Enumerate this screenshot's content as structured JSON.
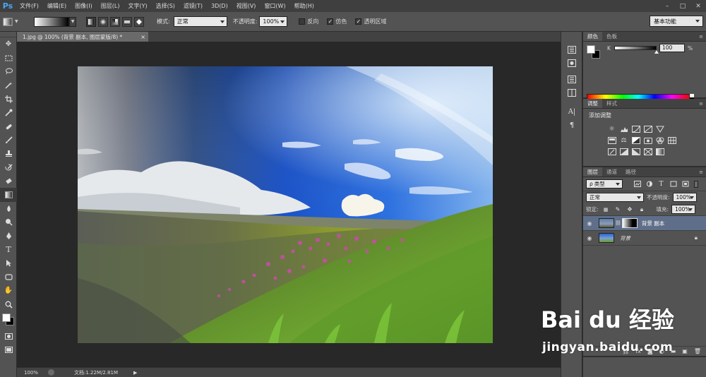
{
  "app": {
    "logo": "Ps"
  },
  "menu": [
    "文件(F)",
    "编辑(E)",
    "图像(I)",
    "图层(L)",
    "文字(Y)",
    "选择(S)",
    "滤镜(T)",
    "3D(D)",
    "视图(V)",
    "窗口(W)",
    "帮助(H)"
  ],
  "window_controls": [
    "–",
    "□",
    "✕"
  ],
  "options": {
    "mode_label": "模式:",
    "mode_value": "正常",
    "opacity_label": "不透明度:",
    "opacity_value": "100%",
    "reverse_label": "反向",
    "dither_label": "仿色",
    "transparency_label": "透明区域",
    "workspace": "基本功能"
  },
  "document": {
    "tab_title": "1.jpg @ 100% (背景 副本, 图层蒙版/8) *",
    "close": "×"
  },
  "status": {
    "zoom": "100%",
    "doc_info": "文档:1.22M/2.81M"
  },
  "color_panel": {
    "tabs": [
      "颜色",
      "色板"
    ],
    "channel": "K",
    "value": "100",
    "unit": "%"
  },
  "adjust_panel": {
    "tabs": [
      "调整",
      "样式"
    ],
    "title": "添加调整"
  },
  "layers_panel": {
    "tabs": [
      "图层",
      "通道",
      "路径"
    ],
    "filter_label": "类型",
    "blend_mode": "正常",
    "opacity_label": "不透明度:",
    "opacity_value": "100%",
    "lock_label": "锁定:",
    "fill_label": "填充:",
    "fill_value": "100%",
    "layers": [
      {
        "name": "背景 副本",
        "selected": true
      },
      {
        "name": "背景",
        "selected": false
      }
    ]
  },
  "watermark": {
    "logo": "Bai du 经验",
    "url": "jingyan.baidu.com"
  },
  "colors": {
    "chrome_dark": "#282828",
    "chrome_mid": "#535353",
    "menubar": "#3f3f3f",
    "selected_layer": "#5f6f8a",
    "ps_blue": "#4aa6f5"
  }
}
